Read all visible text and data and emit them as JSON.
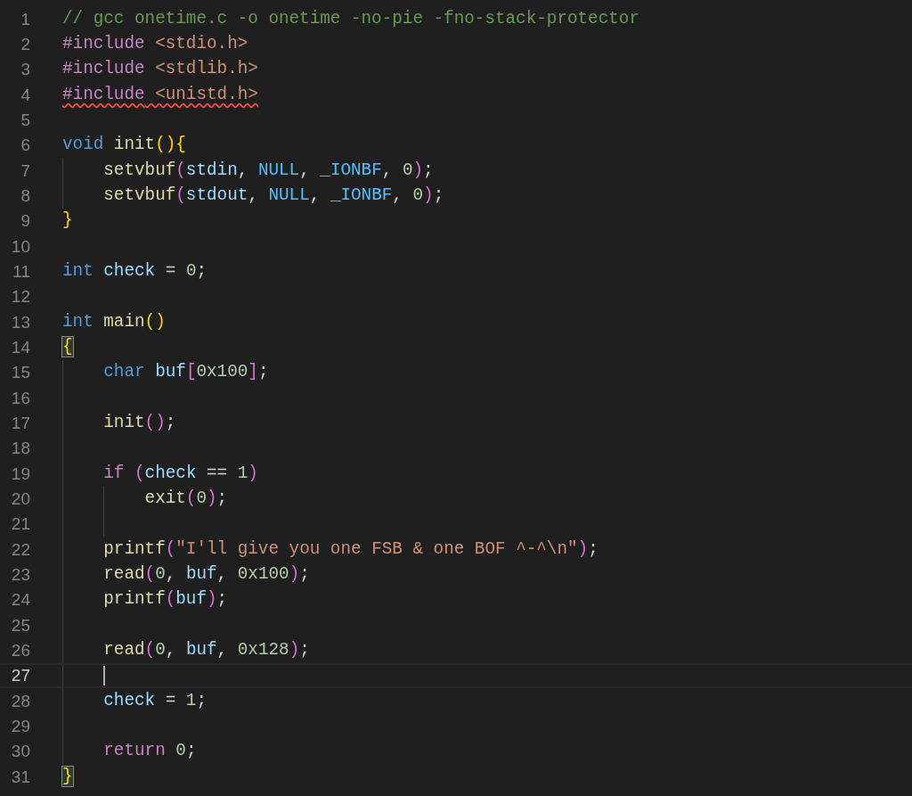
{
  "editor": {
    "lines": [
      {
        "number": "1",
        "tokens": [
          {
            "kind": "comment",
            "text": "// gcc onetime.c -o onetime -no-pie -fno-stack-protector"
          }
        ]
      },
      {
        "number": "2",
        "tokens": [
          {
            "kind": "preprocessor",
            "text": "#include"
          },
          {
            "kind": "header",
            "text": " <stdio.h>"
          }
        ]
      },
      {
        "number": "3",
        "tokens": [
          {
            "kind": "preprocessor",
            "text": "#include"
          },
          {
            "kind": "header",
            "text": " <stdlib.h>"
          }
        ]
      },
      {
        "number": "4",
        "error": true,
        "tokens": [
          {
            "kind": "preprocessor",
            "text": "#include"
          },
          {
            "kind": "header",
            "text": " <unistd.h>"
          }
        ]
      },
      {
        "number": "5"
      },
      {
        "number": "6",
        "tokens": [
          {
            "kind": "keyword",
            "text": "void"
          },
          {
            "kind": "function",
            "text": " init"
          },
          {
            "kind": "bracket1",
            "text": "(){"
          }
        ]
      },
      {
        "number": "7",
        "tokens": [
          {
            "kind": "function",
            "text": "    setvbuf"
          },
          {
            "kind": "bracket2",
            "text": "("
          },
          {
            "kind": "variable",
            "text": "stdin"
          },
          {
            "kind": "plain",
            "text": ", "
          },
          {
            "kind": "constant",
            "text": "NULL"
          },
          {
            "kind": "plain",
            "text": ", "
          },
          {
            "kind": "constant",
            "text": "_IONBF"
          },
          {
            "kind": "plain",
            "text": ", "
          },
          {
            "kind": "number",
            "text": "0"
          },
          {
            "kind": "bracket2",
            "text": ")"
          },
          {
            "kind": "plain",
            "text": ";"
          }
        ]
      },
      {
        "number": "8",
        "tokens": [
          {
            "kind": "function",
            "text": "    setvbuf"
          },
          {
            "kind": "bracket2",
            "text": "("
          },
          {
            "kind": "variable",
            "text": "stdout"
          },
          {
            "kind": "plain",
            "text": ", "
          },
          {
            "kind": "constant",
            "text": "NULL"
          },
          {
            "kind": "plain",
            "text": ", "
          },
          {
            "kind": "constant",
            "text": "_IONBF"
          },
          {
            "kind": "plain",
            "text": ", "
          },
          {
            "kind": "number",
            "text": "0"
          },
          {
            "kind": "bracket2",
            "text": ")"
          },
          {
            "kind": "plain",
            "text": ";"
          }
        ]
      },
      {
        "number": "9",
        "tokens": [
          {
            "kind": "bracket1",
            "text": "}"
          }
        ]
      },
      {
        "number": "10"
      },
      {
        "number": "11",
        "tokens": [
          {
            "kind": "keyword",
            "text": "int"
          },
          {
            "kind": "variable",
            "text": " check"
          },
          {
            "kind": "plain",
            "text": " = "
          },
          {
            "kind": "number",
            "text": "0"
          },
          {
            "kind": "plain",
            "text": ";"
          }
        ]
      },
      {
        "number": "12"
      },
      {
        "number": "13",
        "tokens": [
          {
            "kind": "keyword",
            "text": "int"
          },
          {
            "kind": "function",
            "text": " main"
          },
          {
            "kind": "bracket1",
            "text": "()"
          }
        ]
      },
      {
        "number": "14",
        "tokens": [
          {
            "kind": "bracket1",
            "text": "{",
            "matched": true
          }
        ]
      },
      {
        "number": "15",
        "tokens": [
          {
            "kind": "keyword",
            "text": "    char"
          },
          {
            "kind": "variable",
            "text": " buf"
          },
          {
            "kind": "bracket2",
            "text": "["
          },
          {
            "kind": "number",
            "text": "0x100"
          },
          {
            "kind": "bracket2",
            "text": "]"
          },
          {
            "kind": "plain",
            "text": ";"
          }
        ]
      },
      {
        "number": "16"
      },
      {
        "number": "17",
        "tokens": [
          {
            "kind": "function",
            "text": "    init"
          },
          {
            "kind": "bracket2",
            "text": "()"
          },
          {
            "kind": "plain",
            "text": ";"
          }
        ]
      },
      {
        "number": "18"
      },
      {
        "number": "19",
        "tokens": [
          {
            "kind": "control",
            "text": "    if"
          },
          {
            "kind": "bracket2",
            "text": " ("
          },
          {
            "kind": "variable",
            "text": "check"
          },
          {
            "kind": "plain",
            "text": " == "
          },
          {
            "kind": "number",
            "text": "1"
          },
          {
            "kind": "bracket2",
            "text": ")"
          }
        ]
      },
      {
        "number": "20",
        "tokens": [
          {
            "kind": "function",
            "text": "        exit"
          },
          {
            "kind": "bracket2",
            "text": "("
          },
          {
            "kind": "number",
            "text": "0"
          },
          {
            "kind": "bracket2",
            "text": ")"
          },
          {
            "kind": "plain",
            "text": ";"
          }
        ]
      },
      {
        "number": "21"
      },
      {
        "number": "22",
        "tokens": [
          {
            "kind": "function",
            "text": "    printf"
          },
          {
            "kind": "bracket2",
            "text": "("
          },
          {
            "kind": "string",
            "text": "\"I'll give you one FSB & one BOF ^-^\\n\""
          },
          {
            "kind": "bracket2",
            "text": ")"
          },
          {
            "kind": "plain",
            "text": ";"
          }
        ]
      },
      {
        "number": "23",
        "tokens": [
          {
            "kind": "function",
            "text": "    read"
          },
          {
            "kind": "bracket2",
            "text": "("
          },
          {
            "kind": "number",
            "text": "0"
          },
          {
            "kind": "plain",
            "text": ", "
          },
          {
            "kind": "variable",
            "text": "buf"
          },
          {
            "kind": "plain",
            "text": ", "
          },
          {
            "kind": "number",
            "text": "0x100"
          },
          {
            "kind": "bracket2",
            "text": ")"
          },
          {
            "kind": "plain",
            "text": ";"
          }
        ]
      },
      {
        "number": "24",
        "tokens": [
          {
            "kind": "function",
            "text": "    printf"
          },
          {
            "kind": "bracket2",
            "text": "("
          },
          {
            "kind": "variable",
            "text": "buf"
          },
          {
            "kind": "bracket2",
            "text": ")"
          },
          {
            "kind": "plain",
            "text": ";"
          }
        ]
      },
      {
        "number": "25"
      },
      {
        "number": "26",
        "tokens": [
          {
            "kind": "function",
            "text": "    read"
          },
          {
            "kind": "bracket2",
            "text": "("
          },
          {
            "kind": "number",
            "text": "0"
          },
          {
            "kind": "plain",
            "text": ", "
          },
          {
            "kind": "variable",
            "text": "buf"
          },
          {
            "kind": "plain",
            "text": ", "
          },
          {
            "kind": "number",
            "text": "0x128"
          },
          {
            "kind": "bracket2",
            "text": ")"
          },
          {
            "kind": "plain",
            "text": ";"
          }
        ]
      },
      {
        "number": "27",
        "current": true
      },
      {
        "number": "28",
        "tokens": [
          {
            "kind": "variable",
            "text": "    check"
          },
          {
            "kind": "plain",
            "text": " = "
          },
          {
            "kind": "number",
            "text": "1"
          },
          {
            "kind": "plain",
            "text": ";"
          }
        ]
      },
      {
        "number": "29"
      },
      {
        "number": "30",
        "tokens": [
          {
            "kind": "control",
            "text": "    return"
          },
          {
            "kind": "number",
            "text": " 0"
          },
          {
            "kind": "plain",
            "text": ";"
          }
        ]
      },
      {
        "number": "31",
        "tokens": [
          {
            "kind": "bracket1",
            "text": "}",
            "matched": true
          }
        ]
      }
    ]
  }
}
